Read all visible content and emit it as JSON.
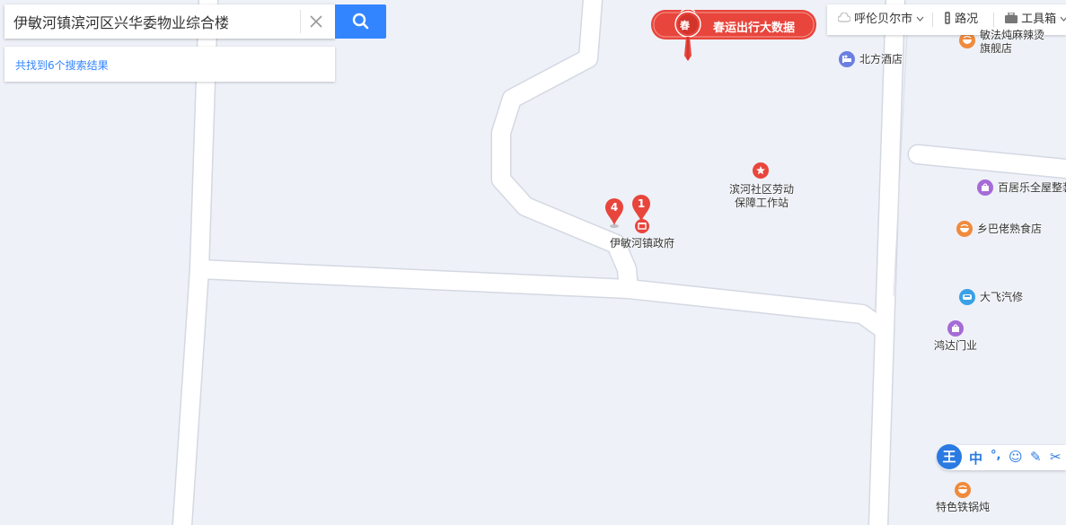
{
  "search": {
    "query": "伊敏河镇滨河区兴华委物业综合楼",
    "result_summary": "共找到6个搜索结果"
  },
  "banner": {
    "char": "春",
    "text": "春运出行大数据"
  },
  "toolbar": {
    "city": "呼伦贝尔市",
    "traffic": "路况",
    "toolbox": "工具箱"
  },
  "markers": [
    {
      "number": "1",
      "label": "伊敏河镇政府"
    },
    {
      "number": "4"
    }
  ],
  "pois": {
    "hotel": "北方酒店",
    "flagship_line1": "敏法炖麻辣烫",
    "flagship_line2": "旗舰店",
    "labor_line1": "滨河社区劳动",
    "labor_line2": "保障工作站",
    "baijule": "百居乐全屋整装",
    "xiangbalao": "乡巴佬熟食店",
    "dafei": "大飞汽修",
    "hongda": "鸿达门业",
    "tese": "特色铁锅炖"
  },
  "ime": {
    "logo": "王",
    "mode": "中",
    "punct": "°,",
    "emoji": "☺",
    "write": "✎",
    "cut": "✂"
  },
  "colors": {
    "map_bg": "#eef1f8",
    "road": "#ffffff",
    "accent": "#3385ff",
    "marker_red": "#e8453c",
    "food_orange": "#f08a3c",
    "shop_purple": "#a56bd6",
    "hotel_blue": "#6a7fe0",
    "service_blue": "#3aa0e8"
  }
}
